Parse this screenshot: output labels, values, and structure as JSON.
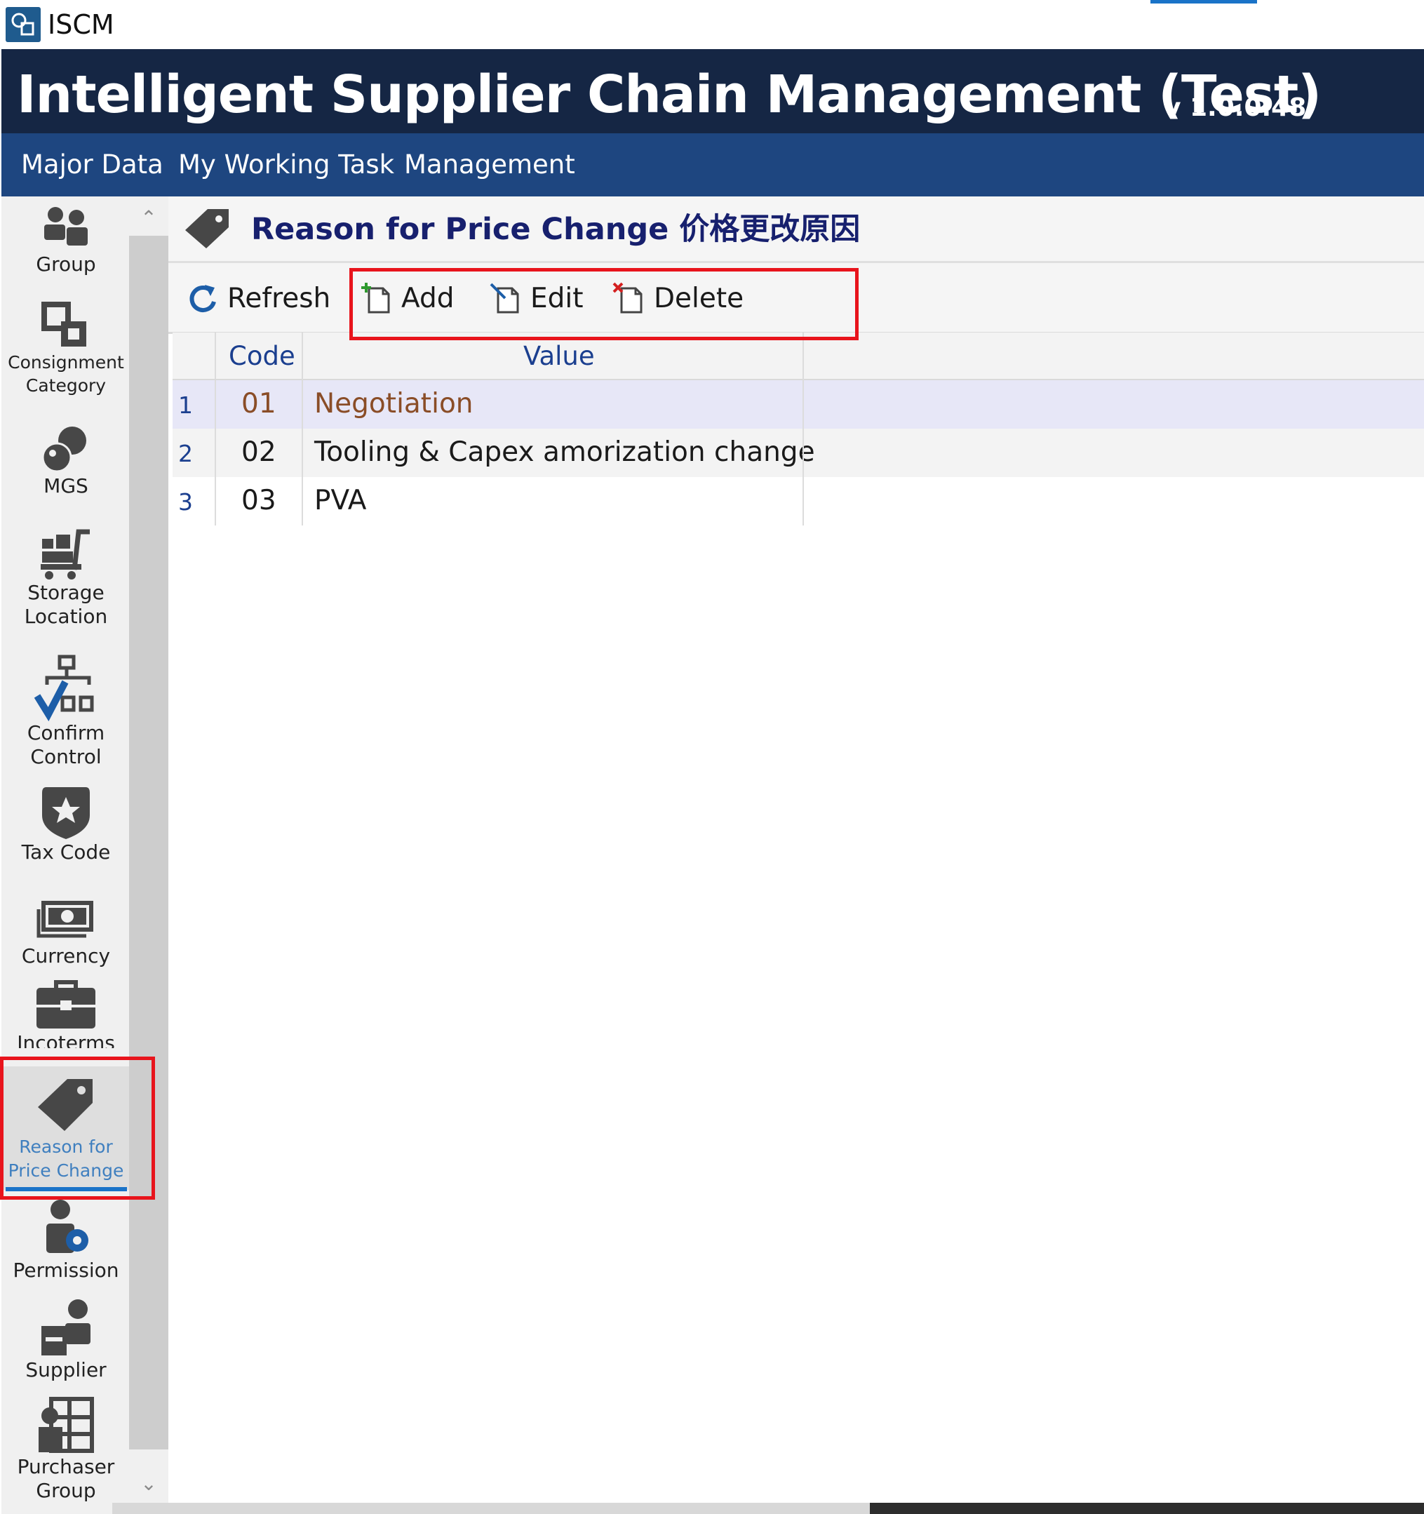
{
  "window": {
    "app_name": "ISCM"
  },
  "banner": {
    "title": "Intelligent Supplier Chain Management (Test)",
    "version": "v 1.0.0.48"
  },
  "menu": [
    "Major Data",
    "My Working Task",
    "Management"
  ],
  "sidebar": {
    "items": [
      {
        "label_lines": [
          "Group"
        ],
        "icon": "group-icon"
      },
      {
        "label_lines": [
          "Consignment",
          "Category"
        ],
        "icon": "consignment-category-icon"
      },
      {
        "label_lines": [
          "MGS"
        ],
        "icon": "mgs-icon"
      },
      {
        "label_lines": [
          "Storage",
          "Location"
        ],
        "icon": "storage-location-icon"
      },
      {
        "label_lines": [
          "Confirm",
          "Control"
        ],
        "icon": "confirm-control-icon"
      },
      {
        "label_lines": [
          "Tax Code"
        ],
        "icon": "tax-code-icon"
      },
      {
        "label_lines": [
          "Currency"
        ],
        "icon": "currency-icon"
      },
      {
        "label_lines": [
          "Incoterms"
        ],
        "icon": "incoterms-icon"
      },
      {
        "label_lines": [
          "Reason for",
          "Price Change"
        ],
        "icon": "price-tag-icon",
        "active": true
      },
      {
        "label_lines": [
          "Permission"
        ],
        "icon": "permission-icon"
      },
      {
        "label_lines": [
          "Supplier"
        ],
        "icon": "supplier-icon"
      },
      {
        "label_lines": [
          "Purchaser",
          "Group"
        ],
        "icon": "purchaser-group-icon"
      }
    ]
  },
  "page": {
    "title": "Reason for Price Change 价格更改原因",
    "icon": "price-tag-icon"
  },
  "toolbar": {
    "refresh": "Refresh",
    "add": "Add",
    "edit": "Edit",
    "delete": "Delete"
  },
  "grid": {
    "columns": [
      "Code",
      "Value"
    ],
    "rows": [
      {
        "num": "1",
        "code": "01",
        "value": "Negotiation",
        "selected": true
      },
      {
        "num": "2",
        "code": "02",
        "value": "Tooling & Capex amorization change"
      },
      {
        "num": "3",
        "code": "03",
        "value": "PVA"
      }
    ]
  },
  "colors": {
    "banner_bg": "#152644",
    "menu_bg": "#1e4680",
    "title_text": "#17206e",
    "highlight_box": "#e8141c",
    "active_accent": "#1a73c8"
  }
}
